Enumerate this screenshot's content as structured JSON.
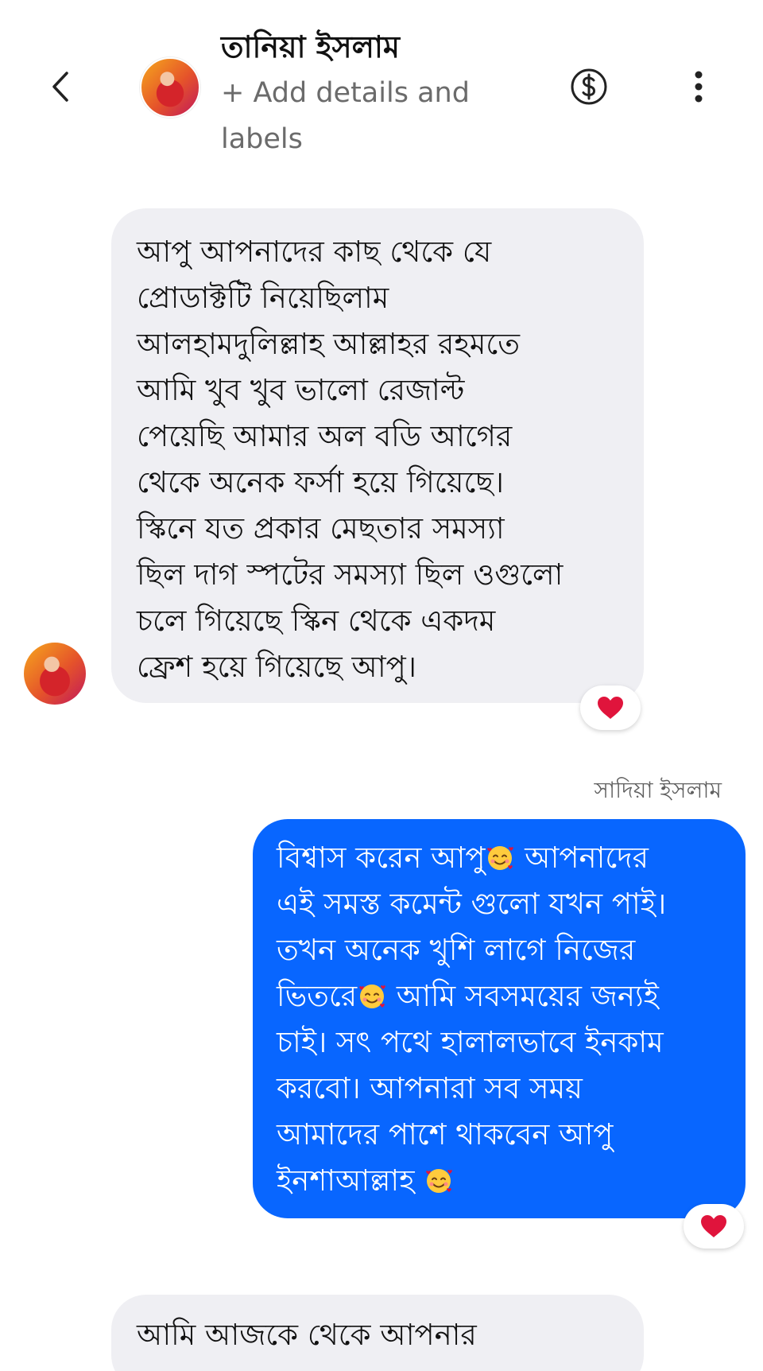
{
  "header": {
    "contact_name": "তানিয়া ইসলাম",
    "subtitle": "+ Add details and labels",
    "icons": {
      "back": "chevron-left-icon",
      "payment": "dollar-circle-icon",
      "more": "more-vertical-icon"
    }
  },
  "messages": [
    {
      "direction": "incoming",
      "text": "আপু আপনাদের কাছ থেকে যে\nপ্রোডাক্টটি নিয়েছিলাম\nআলহামদুলিল্লাহ আল্লাহর রহমতে\nআমি খুব খুব ভালো রেজাল্ট\nপেয়েছি আমার অল বডি আগের\nথেকে অনেক ফর্সা হয়ে গিয়েছে।\nস্কিনে যত প্রকার মেছতার সমস্যা\nছিল দাগ স্পটের সমস্যা ছিল ওগুলো\nচলে গিয়েছে স্কিন থেকে  একদম\nফ্রেশ হয়ে গিয়েছে আপু।",
      "reaction": "❤️"
    },
    {
      "direction": "outgoing",
      "sender": "সাদিয়া ইসলাম",
      "segments": [
        "বিশ্বাস করেন আপু",
        " আপনাদের\nএই সমস্ত কমেন্ট গুলো যখন পাই।\nতখন অনেক খুশি লাগে নিজের\nভিতরে",
        " আমি সবসময়ের জন্যই\nচাই। সৎ পথে হালালভাবে ইনকাম\nকরবো। আপনারা সব সময়\nআমাদের পাশে থাকবেন আপু\nইনশাআল্লাহ "
      ],
      "emoji": "smiling-face-with-hearts-icon",
      "reaction": "❤️"
    },
    {
      "direction": "incoming",
      "text": "আমি আজকে থেকে আপনার"
    }
  ],
  "colors": {
    "outgoing_bubble": "#0866ff",
    "incoming_bubble": "#efeff3",
    "reaction_heart": "#e0143c",
    "subtitle_text": "#6b6b6b"
  }
}
